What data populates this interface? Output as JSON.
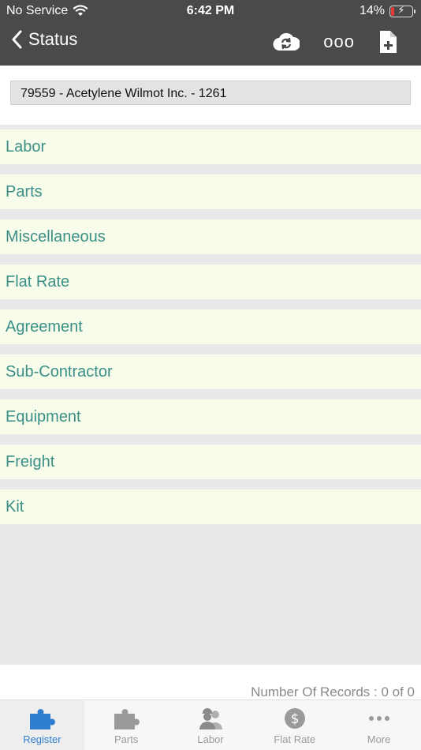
{
  "status_bar": {
    "carrier": "No Service",
    "time": "6:42 PM",
    "battery": "14%"
  },
  "nav": {
    "back_label": "Status",
    "more_label": "ooo"
  },
  "search": {
    "value": "79559 - Acetylene Wilmot Inc. - 1261"
  },
  "list": {
    "items": [
      {
        "label": "Labor"
      },
      {
        "label": "Parts"
      },
      {
        "label": "Miscellaneous"
      },
      {
        "label": "Flat Rate"
      },
      {
        "label": "Agreement"
      },
      {
        "label": "Sub-Contractor"
      },
      {
        "label": "Equipment"
      },
      {
        "label": "Freight"
      },
      {
        "label": "Kit"
      }
    ]
  },
  "footer": {
    "records": "Number Of Records : 0 of 0"
  },
  "tabs": [
    {
      "label": "Register",
      "icon": "puzzle-icon",
      "active": true
    },
    {
      "label": "Parts",
      "icon": "puzzle-icon"
    },
    {
      "label": "Labor",
      "icon": "workers-icon"
    },
    {
      "label": "Flat Rate",
      "icon": "dollar-icon"
    },
    {
      "label": "More",
      "icon": "ellipsis-icon"
    }
  ],
  "colors": {
    "header_bg": "#4a4a4a",
    "item_text": "#3a8f86",
    "item_bg": "#f8fceb",
    "active_tab": "#2f7fd0",
    "inactive_tab": "#9a9a9a"
  }
}
